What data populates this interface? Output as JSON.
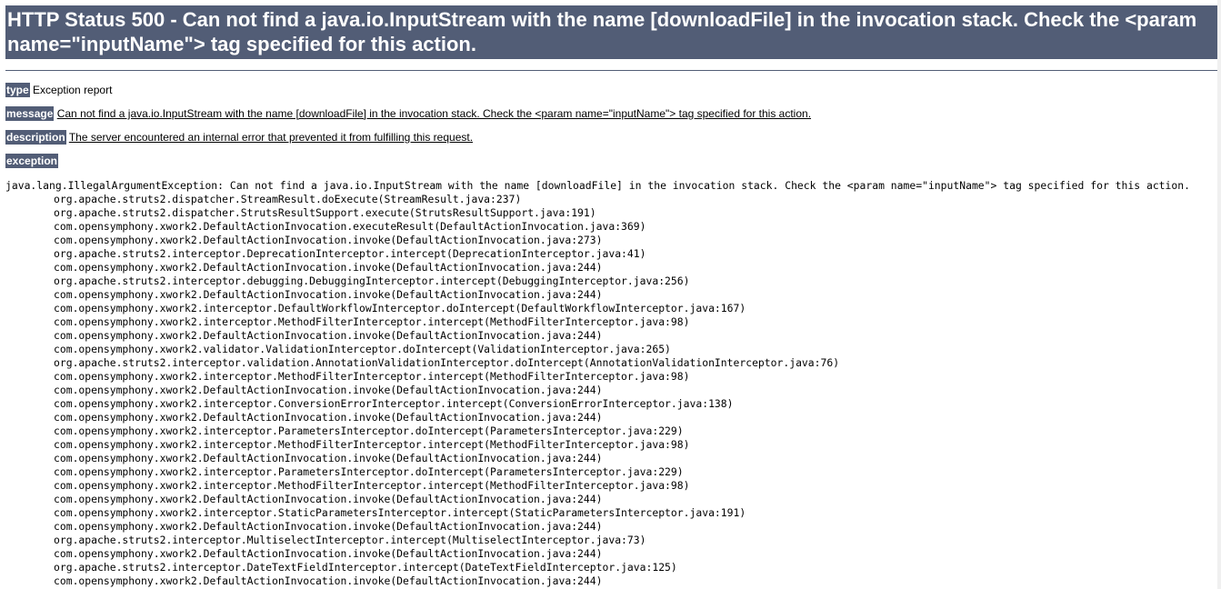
{
  "header": {
    "title": "HTTP Status 500 - Can not find a java.io.InputStream with the name [downloadFile] in the invocation stack. Check the <param name=\"inputName\"> tag specified for this action."
  },
  "report": {
    "type_label": "type",
    "type_value": "Exception report",
    "message_label": "message",
    "message_value": "Can not find a java.io.InputStream with the name [downloadFile] in the invocation stack. Check the <param name=\"inputName\"> tag specified for this action.",
    "description_label": "description",
    "description_value": "The server encountered an internal error that prevented it from fulfilling this request.",
    "exception_label": "exception"
  },
  "trace": {
    "first_line": "java.lang.IllegalArgumentException: Can not find a java.io.InputStream with the name [downloadFile] in the invocation stack. Check the <param name=\"inputName\"> tag specified for this action.",
    "frames": [
      "org.apache.struts2.dispatcher.StreamResult.doExecute(StreamResult.java:237)",
      "org.apache.struts2.dispatcher.StrutsResultSupport.execute(StrutsResultSupport.java:191)",
      "com.opensymphony.xwork2.DefaultActionInvocation.executeResult(DefaultActionInvocation.java:369)",
      "com.opensymphony.xwork2.DefaultActionInvocation.invoke(DefaultActionInvocation.java:273)",
      "org.apache.struts2.interceptor.DeprecationInterceptor.intercept(DeprecationInterceptor.java:41)",
      "com.opensymphony.xwork2.DefaultActionInvocation.invoke(DefaultActionInvocation.java:244)",
      "org.apache.struts2.interceptor.debugging.DebuggingInterceptor.intercept(DebuggingInterceptor.java:256)",
      "com.opensymphony.xwork2.DefaultActionInvocation.invoke(DefaultActionInvocation.java:244)",
      "com.opensymphony.xwork2.interceptor.DefaultWorkflowInterceptor.doIntercept(DefaultWorkflowInterceptor.java:167)",
      "com.opensymphony.xwork2.interceptor.MethodFilterInterceptor.intercept(MethodFilterInterceptor.java:98)",
      "com.opensymphony.xwork2.DefaultActionInvocation.invoke(DefaultActionInvocation.java:244)",
      "com.opensymphony.xwork2.validator.ValidationInterceptor.doIntercept(ValidationInterceptor.java:265)",
      "org.apache.struts2.interceptor.validation.AnnotationValidationInterceptor.doIntercept(AnnotationValidationInterceptor.java:76)",
      "com.opensymphony.xwork2.interceptor.MethodFilterInterceptor.intercept(MethodFilterInterceptor.java:98)",
      "com.opensymphony.xwork2.DefaultActionInvocation.invoke(DefaultActionInvocation.java:244)",
      "com.opensymphony.xwork2.interceptor.ConversionErrorInterceptor.intercept(ConversionErrorInterceptor.java:138)",
      "com.opensymphony.xwork2.DefaultActionInvocation.invoke(DefaultActionInvocation.java:244)",
      "com.opensymphony.xwork2.interceptor.ParametersInterceptor.doIntercept(ParametersInterceptor.java:229)",
      "com.opensymphony.xwork2.interceptor.MethodFilterInterceptor.intercept(MethodFilterInterceptor.java:98)",
      "com.opensymphony.xwork2.DefaultActionInvocation.invoke(DefaultActionInvocation.java:244)",
      "com.opensymphony.xwork2.interceptor.ParametersInterceptor.doIntercept(ParametersInterceptor.java:229)",
      "com.opensymphony.xwork2.interceptor.MethodFilterInterceptor.intercept(MethodFilterInterceptor.java:98)",
      "com.opensymphony.xwork2.DefaultActionInvocation.invoke(DefaultActionInvocation.java:244)",
      "com.opensymphony.xwork2.interceptor.StaticParametersInterceptor.intercept(StaticParametersInterceptor.java:191)",
      "com.opensymphony.xwork2.DefaultActionInvocation.invoke(DefaultActionInvocation.java:244)",
      "org.apache.struts2.interceptor.MultiselectInterceptor.intercept(MultiselectInterceptor.java:73)",
      "com.opensymphony.xwork2.DefaultActionInvocation.invoke(DefaultActionInvocation.java:244)",
      "org.apache.struts2.interceptor.DateTextFieldInterceptor.intercept(DateTextFieldInterceptor.java:125)",
      "com.opensymphony.xwork2.DefaultActionInvocation.invoke(DefaultActionInvocation.java:244)"
    ]
  },
  "colors": {
    "header_bg": "#525d76",
    "header_text": "#ffffff"
  }
}
